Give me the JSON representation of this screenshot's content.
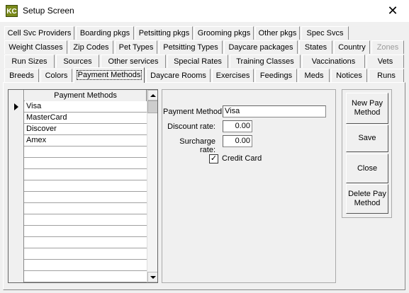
{
  "window": {
    "title": "Setup Screen",
    "icon_text": "KC",
    "close_glyph": "✕"
  },
  "tabs": {
    "row1": [
      "Cell Svc Providers",
      "Boarding pkgs",
      "Petsitting pkgs",
      "Grooming pkgs",
      "Other pkgs",
      "Spec Svcs"
    ],
    "row2": [
      "Weight Classes",
      "Zip Codes",
      "Pet Types",
      "Petsitting Types",
      "Daycare packages",
      "States",
      "Country",
      "Zones"
    ],
    "row3": [
      "Run Sizes",
      "Sources",
      "Other services",
      "Special Rates",
      "Training Classes",
      "Vaccinations",
      "Vets"
    ],
    "row4": [
      "Breeds",
      "Colors",
      "Payment Methods",
      "Daycare Rooms",
      "Exercises",
      "Feedings",
      "Meds",
      "Notices",
      "Runs"
    ],
    "active": "Payment Methods"
  },
  "grid": {
    "header": "Payment Methods",
    "rows": [
      "Visa",
      "MasterCard",
      "Discover",
      "Amex",
      "",
      "",
      "",
      "",
      "",
      "",
      "",
      "",
      "",
      "",
      "",
      ""
    ]
  },
  "form": {
    "payment_method_label": "Payment Method:",
    "payment_method_value": "Visa",
    "discount_label": "Discount rate:",
    "discount_value": "0.00",
    "surcharge_label": "Surcharge rate:",
    "surcharge_value": "0.00",
    "credit_card_label": "Credit Card",
    "credit_card_checked": "✓"
  },
  "buttons": {
    "new": "New Pay\nMethod",
    "save": "Save",
    "close": "Close",
    "delete": "Delete Pay\nMethod"
  }
}
